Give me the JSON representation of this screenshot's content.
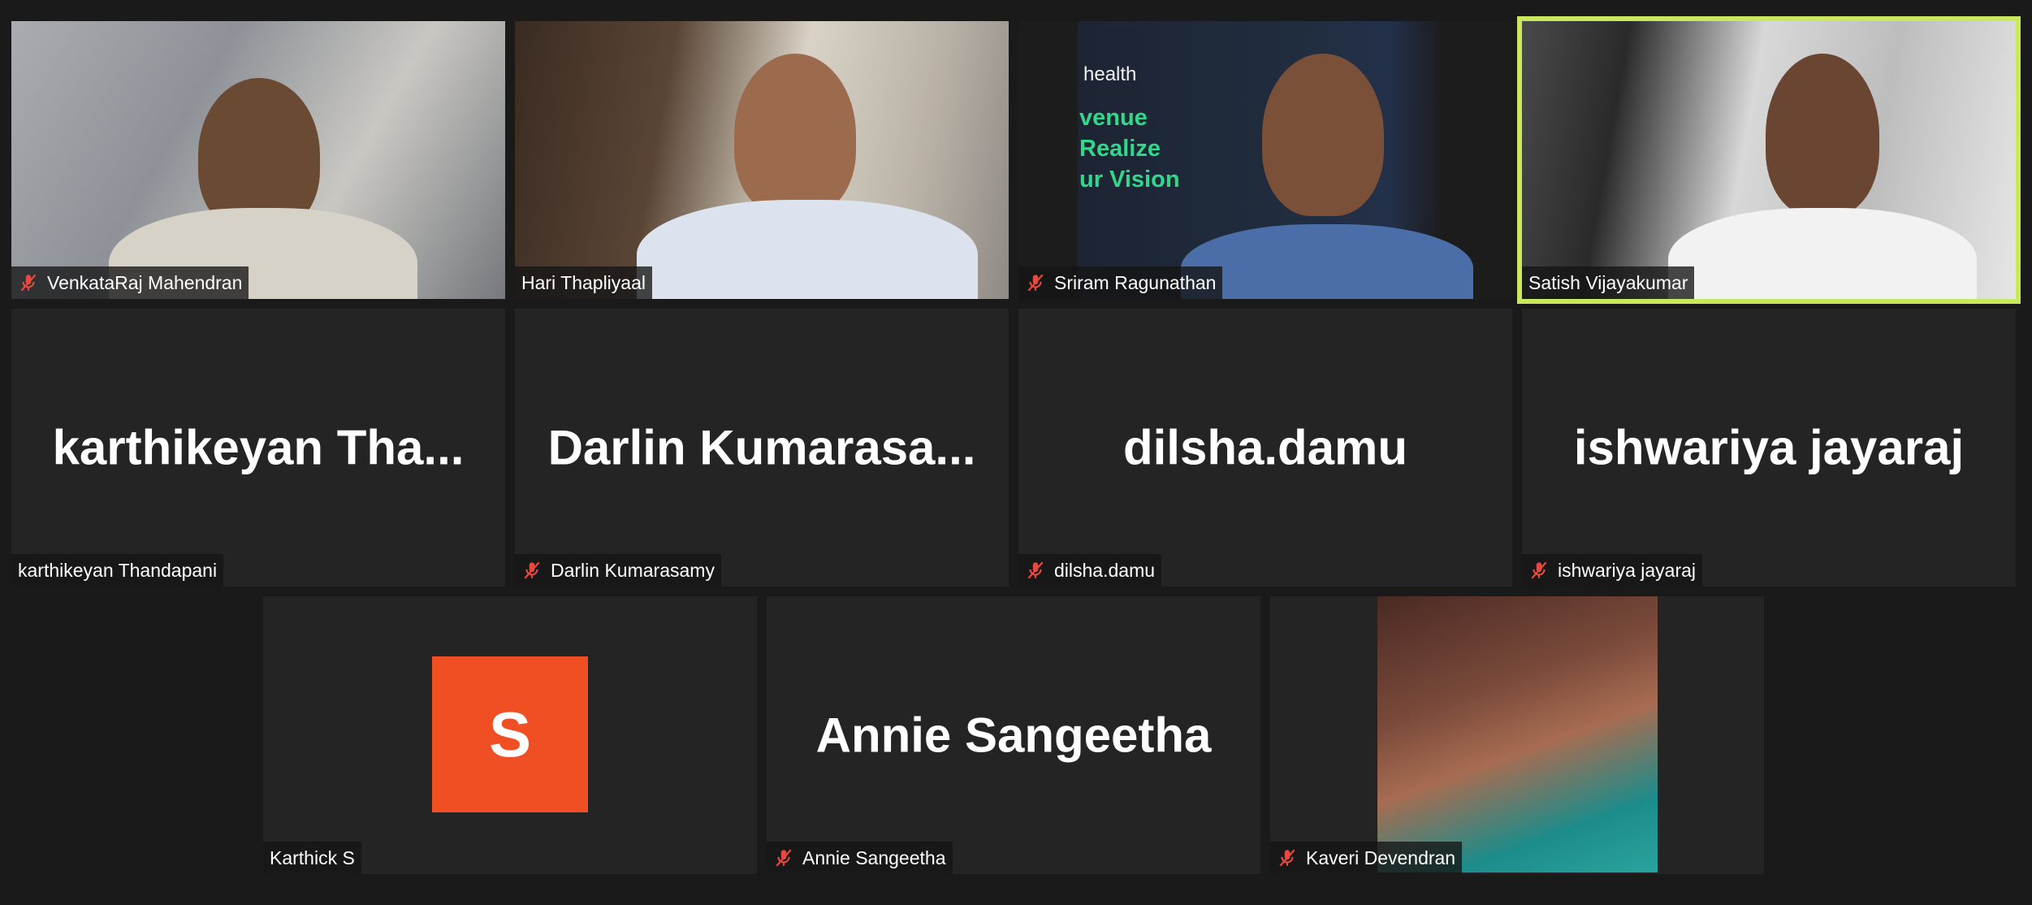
{
  "participants": [
    {
      "name": "VenkataRaj Mahendran",
      "muted": true
    },
    {
      "name": "Hari Thapliyaal",
      "muted": false
    },
    {
      "name": "Sriram Ragunathan",
      "muted": true
    },
    {
      "name": "Satish Vijayakumar",
      "muted": false,
      "speaking": true
    },
    {
      "name": "karthikeyan Thandapani",
      "display": "karthikeyan  Tha...",
      "muted": false
    },
    {
      "name": "Darlin Kumarasamy",
      "display": "Darlin  Kumarasa...",
      "muted": true
    },
    {
      "name": "dilsha.damu",
      "display": "dilsha.damu",
      "muted": true
    },
    {
      "name": "ishwariya jayaraj",
      "display": "ishwariya jayaraj",
      "muted": true
    },
    {
      "name": "Karthick S",
      "avatar_letter": "S",
      "avatar_color": "#f04f23",
      "muted": false
    },
    {
      "name": "Annie Sangeetha",
      "display": "Annie Sangeetha",
      "muted": true
    },
    {
      "name": "Kaveri Devendran",
      "muted": true
    }
  ],
  "video_background_text": {
    "brand": "health",
    "lines": [
      "venue",
      "Realize",
      "ur Vision"
    ]
  },
  "colors": {
    "active_speaker_border": "#c9e75f",
    "muted_icon": "#e8483e",
    "tile_bg": "#242424"
  }
}
